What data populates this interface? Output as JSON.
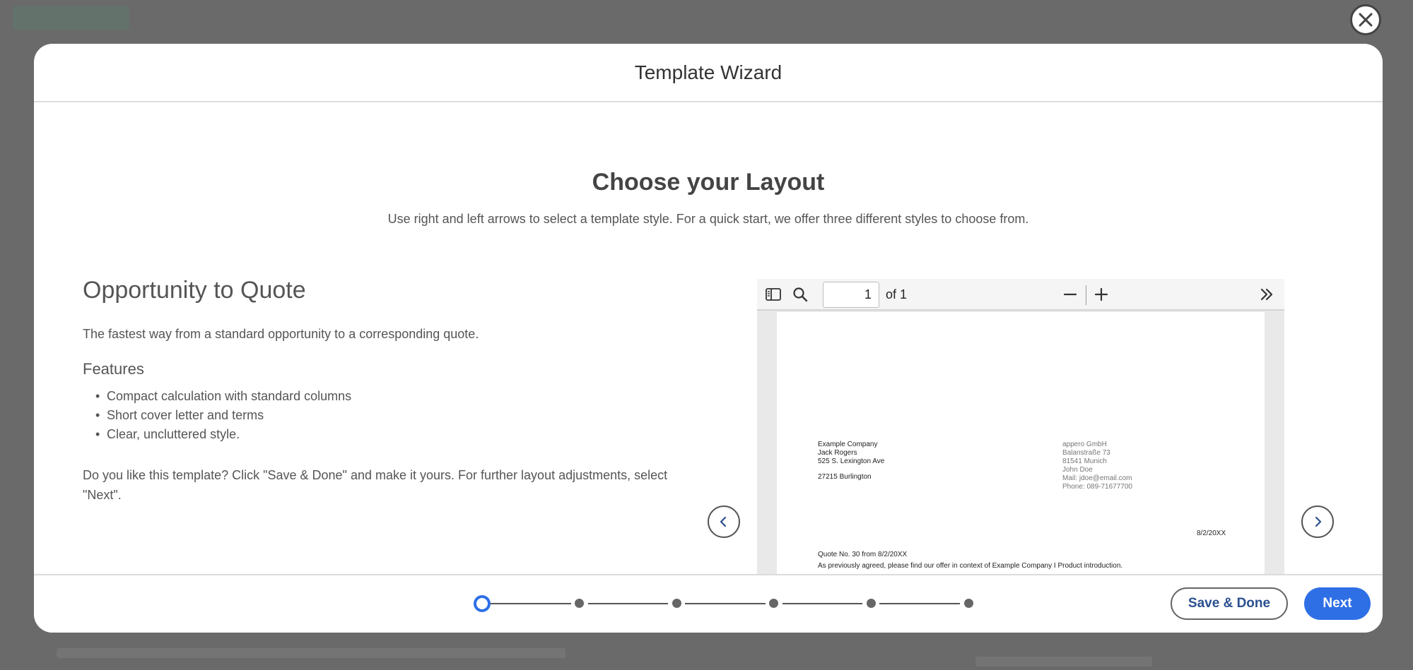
{
  "modal": {
    "title": "Template Wizard"
  },
  "layout": {
    "heading": "Choose your Layout",
    "description": "Use right and left arrows to select a template style. For a quick start, we offer three different styles to choose from."
  },
  "template": {
    "name": "Opportunity to Quote",
    "description": "The fastest way from a standard opportunity to a corresponding quote.",
    "features_heading": "Features",
    "features": [
      "Compact calculation with standard columns",
      "Short cover letter and terms",
      "Clear, uncluttered style."
    ],
    "cta": "Do you like this template? Click \"Save & Done\" and make it yours. For further layout adjustments, select \"Next\"."
  },
  "pdf_viewer": {
    "page_value": "1",
    "page_total_label": "of 1",
    "document": {
      "recipient": [
        "Example Company",
        "Jack Rogers",
        "525 S. Lexington Ave"
      ],
      "recipient_city": "27215 Burlington",
      "sender": [
        "appero GmbH",
        "Balanstraße 73",
        "81541 Munich",
        "John Doe",
        "Mail: jdoe@email.com",
        "Phone: 089-71677700"
      ],
      "date": "8/2/20XX",
      "quote_number": "Quote No. 30 from 8/2/20XX",
      "quote_text": "As previously agreed, please find our offer in context of Example Company I Product introduction."
    }
  },
  "stepper": {
    "total_steps": 6,
    "current_step": 1
  },
  "footer": {
    "save_label": "Save & Done",
    "next_label": "Next"
  },
  "colors": {
    "accent": "#2e6fe6",
    "save_text": "#2a4f8f",
    "overlay": "#5c5c5c"
  },
  "icons": {
    "close": "close-icon",
    "sidebar_toggle": "sidebar-toggle-icon",
    "search": "search-icon",
    "zoom_out": "minus-icon",
    "zoom_in": "plus-icon",
    "more": "double-chevron-right-icon",
    "prev": "chevron-left-icon",
    "next": "chevron-right-icon"
  }
}
